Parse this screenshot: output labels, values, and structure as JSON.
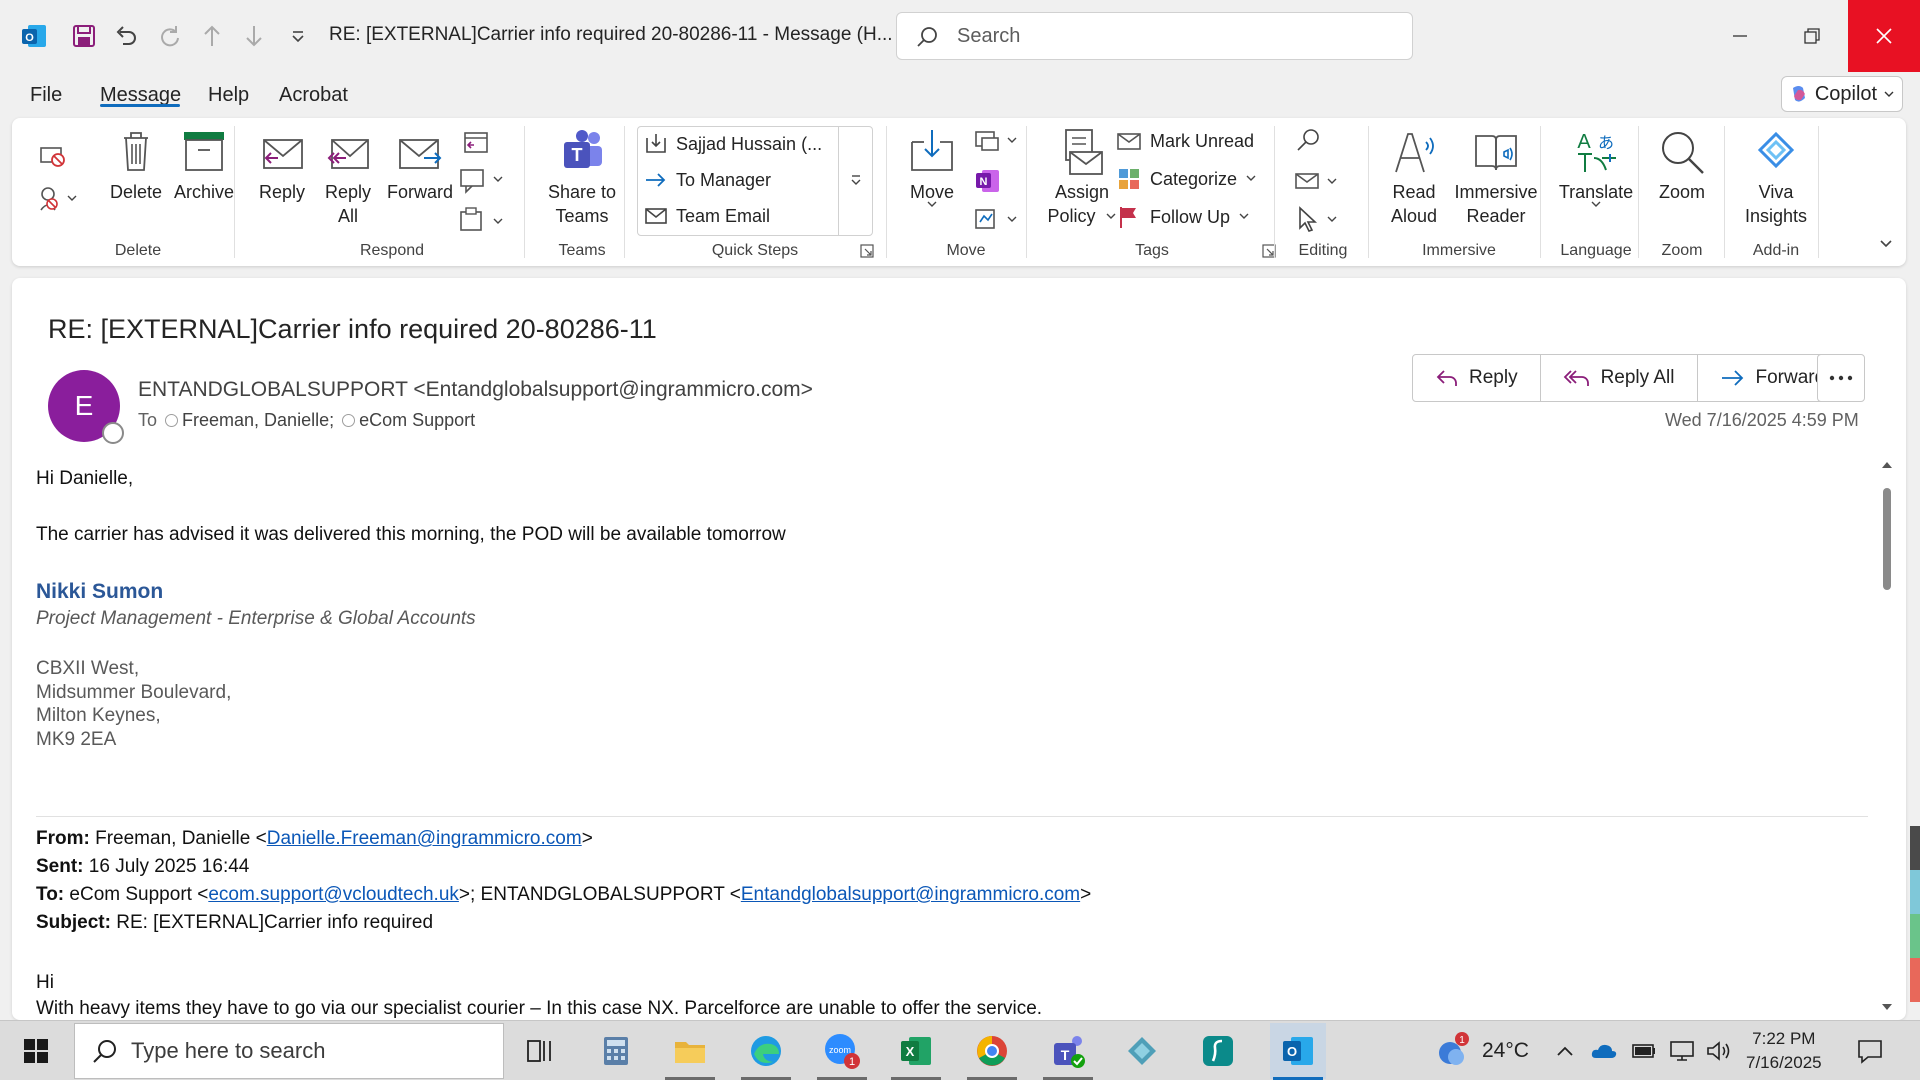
{
  "title_bar": {
    "title": "RE: [EXTERNAL]Carrier info required 20-80286-11  -  Message (H...",
    "search_placeholder": "Search"
  },
  "menu": {
    "items": [
      "File",
      "Message",
      "Help",
      "Acrobat"
    ],
    "active": "Message",
    "copilot_label": "Copilot"
  },
  "ribbon": {
    "groups": {
      "delete": "Delete",
      "respond": "Respond",
      "teams": "Teams",
      "quick_steps": "Quick Steps",
      "move": "Move",
      "tags": "Tags",
      "editing": "Editing",
      "immersive": "Immersive",
      "language": "Language",
      "zoom": "Zoom",
      "addin": "Add-in"
    },
    "buttons": {
      "delete": "Delete",
      "archive": "Archive",
      "reply": "Reply",
      "reply_all_1": "Reply",
      "reply_all_2": "All",
      "forward": "Forward",
      "share_teams_1": "Share to",
      "share_teams_2": "Teams",
      "move": "Move",
      "assign_policy_1": "Assign",
      "assign_policy_2": "Policy",
      "mark_unread": "Mark Unread",
      "categorize": "Categorize",
      "follow_up": "Follow Up",
      "read_aloud_1": "Read",
      "read_aloud_2": "Aloud",
      "immersive_reader_1": "Immersive",
      "immersive_reader_2": "Reader",
      "translate": "Translate",
      "zoom": "Zoom",
      "viva_1": "Viva",
      "viva_2": "Insights"
    },
    "quick_steps": [
      "Sajjad Hussain (...",
      "To Manager",
      "Team Email"
    ]
  },
  "message": {
    "subject": "RE: [EXTERNAL]Carrier info required 20-80286-11",
    "avatar_initial": "E",
    "sender": "ENTANDGLOBALSUPPORT <Entandglobalsupport@ingrammicro.com>",
    "to_label": "To",
    "recipients": [
      "Freeman, Danielle;",
      "eCom Support"
    ],
    "date": "Wed 7/16/2025 4:59 PM",
    "actions": {
      "reply": "Reply",
      "reply_all": "Reply All",
      "forward": "Forward"
    }
  },
  "body": {
    "greeting": "Hi Danielle,",
    "text": "The carrier has advised it was delivered this morning, the POD will be available tomorrow",
    "sig_name": "Nikki Sumon",
    "sig_role": "Project Management - Enterprise & Global Accounts",
    "address": [
      "CBXII West,",
      "Midsummer Boulevard,",
      "Milton Keynes,",
      "MK9 2EA"
    ],
    "quoted": {
      "from_label": "From:",
      "from_name": " Freeman, Danielle <",
      "from_email": "Danielle.Freeman@ingrammicro.com",
      "from_end": ">",
      "sent_label": "Sent:",
      "sent_value": " 16 July 2025 16:44",
      "to_label": "To:",
      "to_pre": " eCom Support <",
      "to_email1": "ecom.support@vcloudtech.uk",
      "to_mid": ">; ENTANDGLOBALSUPPORT <",
      "to_email2": "Entandglobalsupport@ingrammicro.com",
      "to_end": ">",
      "subject_label": "Subject:",
      "subject_value": " RE: [EXTERNAL]Carrier info required",
      "hi": "Hi",
      "line": "With heavy items they have to go via our specialist courier – In this case NX. Parcelforce are unable to offer the service."
    }
  },
  "taskbar": {
    "search_placeholder": "Type here to search",
    "weather_badge": "1",
    "temperature": "24°C",
    "zoom_badge": "1",
    "time": "7:22 PM",
    "date": "7/16/2025"
  },
  "colors": {
    "accent": "#0f6cbd",
    "close_red": "#e81123",
    "avatar": "#8a1e9c",
    "signature_blue": "#2b5797",
    "link": "#0b57b7"
  }
}
